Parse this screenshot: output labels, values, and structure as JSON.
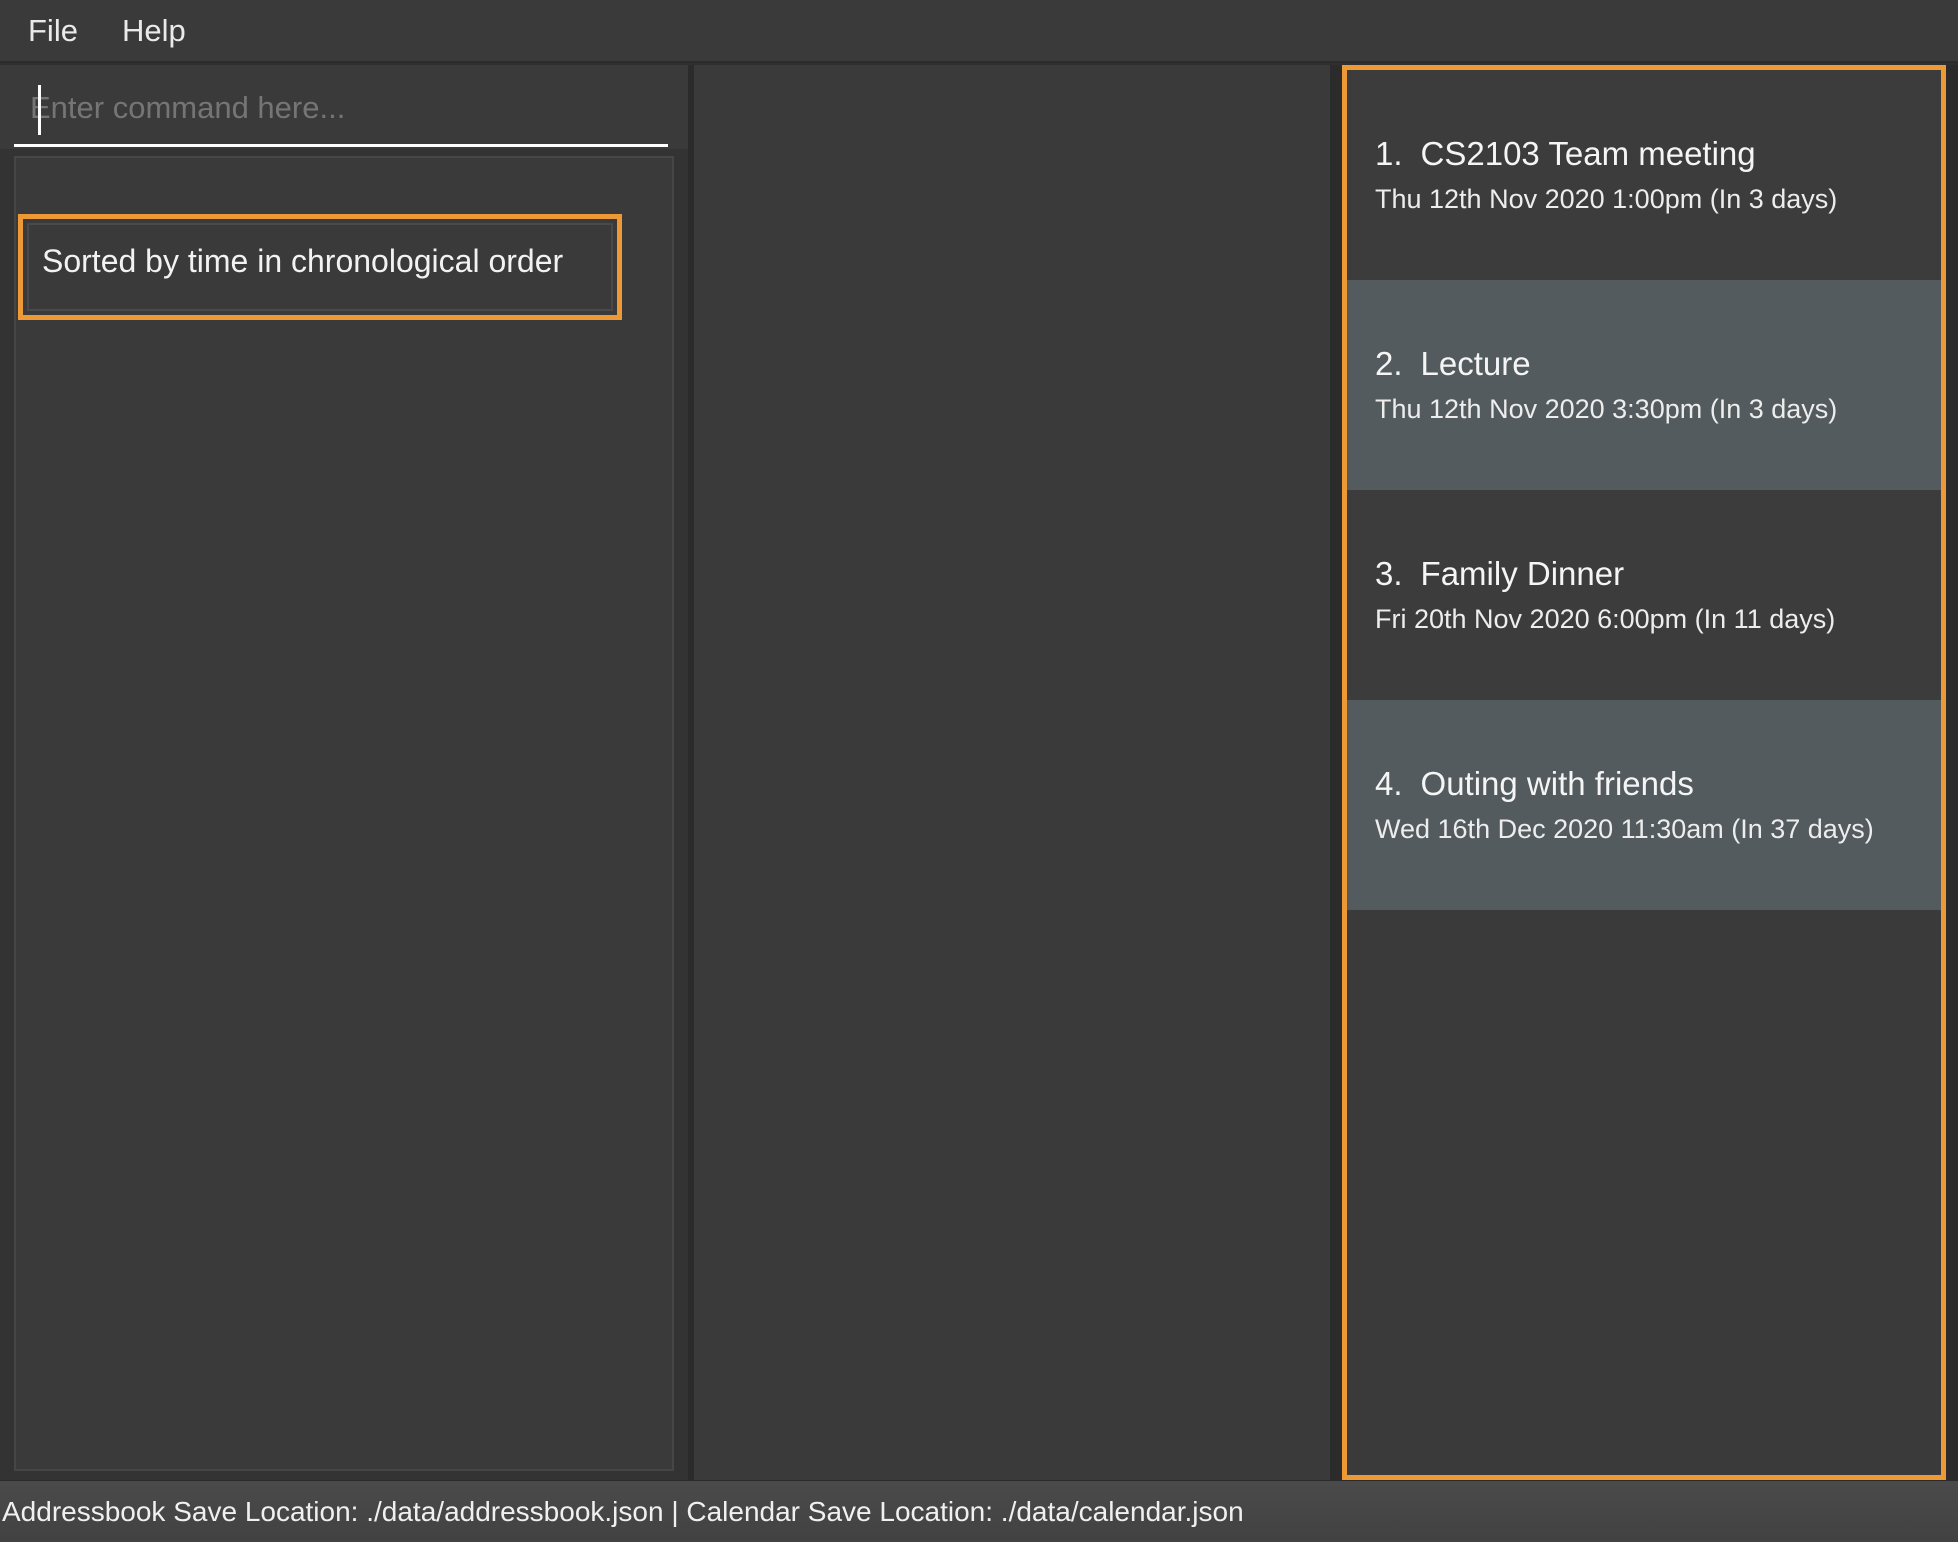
{
  "menu": {
    "items": [
      {
        "label": "File"
      },
      {
        "label": "Help"
      }
    ]
  },
  "command_box": {
    "value": "",
    "placeholder": "Enter command here..."
  },
  "result_display": {
    "text": "Sorted by time in chronological order"
  },
  "event_list": {
    "events": [
      {
        "index": "1.",
        "name": "CS2103 Team meeting",
        "datetime": "Thu 12th Nov 2020 1:00pm (In 3 days)"
      },
      {
        "index": "2.",
        "name": "Lecture",
        "datetime": "Thu 12th Nov 2020 3:30pm (In 3 days)"
      },
      {
        "index": "3.",
        "name": "Family Dinner",
        "datetime": "Fri 20th Nov 2020 6:00pm (In 11 days)"
      },
      {
        "index": "4.",
        "name": "Outing with friends",
        "datetime": "Wed 16th Dec 2020 11:30am (In 37 days)"
      }
    ]
  },
  "status_bar": {
    "text": "Addressbook Save Location: ./data/addressbook.json | Calendar Save Location: ./data/calendar.json"
  },
  "colors": {
    "highlight_orange": "#ED9A36",
    "background_dark": "#3A3A3A",
    "row_alt": "#535B5E",
    "row_base": "#3C3C3C",
    "text": "#F2F2F2"
  }
}
